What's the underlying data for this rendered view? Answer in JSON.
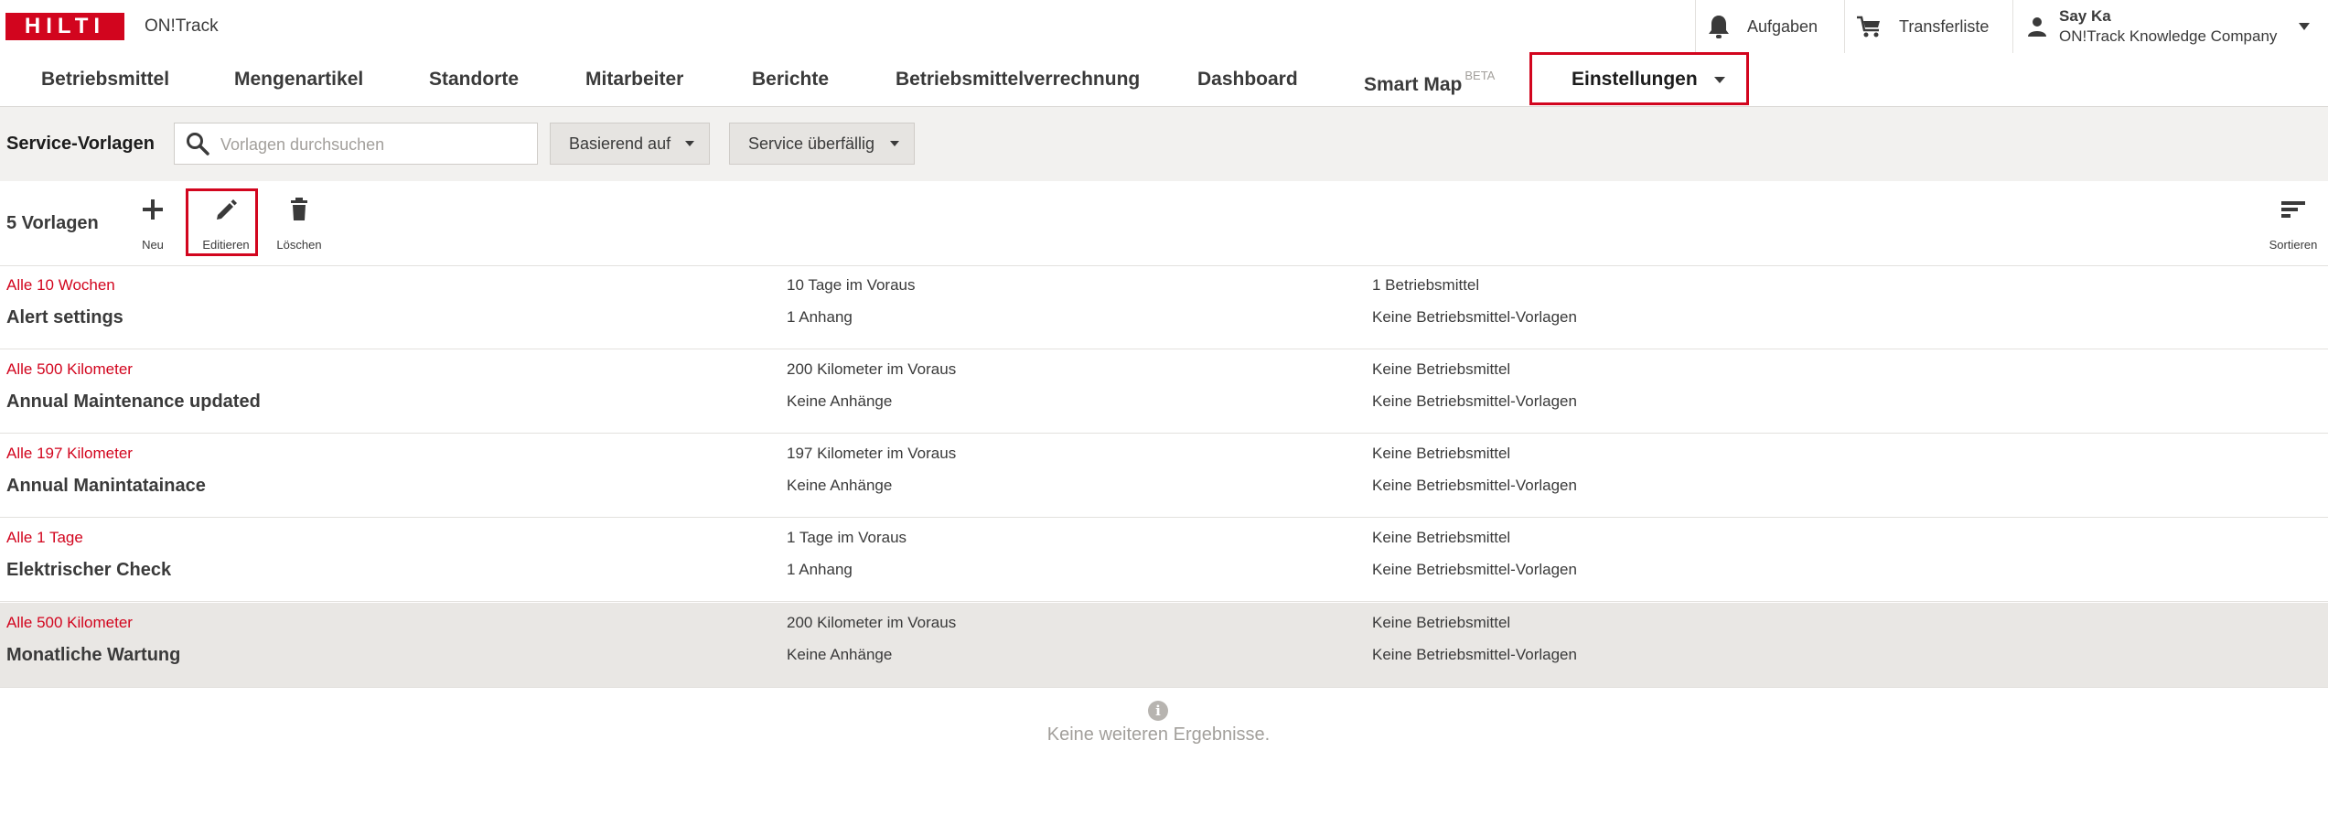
{
  "header": {
    "logo": "HILTI",
    "app_name": "ON!Track",
    "tasks_label": "Aufgaben",
    "transfer_label": "Transferliste",
    "user_name": "Say Ka",
    "company": "ON!Track Knowledge Company"
  },
  "nav": {
    "items": [
      "Betriebsmittel",
      "Mengenartikel",
      "Standorte",
      "Mitarbeiter",
      "Berichte",
      "Betriebsmittelverrechnung",
      "Dashboard",
      "Smart Map"
    ],
    "smart_map_badge": "BETA",
    "active": "Einstellungen"
  },
  "filter": {
    "title": "Service-Vorlagen",
    "search_placeholder": "Vorlagen durchsuchen",
    "dropdown1": "Basierend auf",
    "dropdown2": "Service überfällig"
  },
  "toolbar": {
    "count": "5 Vorlagen",
    "new_label": "Neu",
    "edit_label": "Editieren",
    "delete_label": "Löschen",
    "sort_label": "Sortieren"
  },
  "rows": [
    {
      "interval": "Alle 10 Wochen",
      "name": "Alert settings",
      "advance": "10 Tage im Voraus",
      "attachments": "1 Anhang",
      "assets": "1 Betriebsmittel",
      "templates": "Keine Betriebsmittel-Vorlagen"
    },
    {
      "interval": "Alle 500 Kilometer",
      "name": "Annual Maintenance updated",
      "advance": "200 Kilometer im Voraus",
      "attachments": "Keine Anhänge",
      "assets": "Keine Betriebsmittel",
      "templates": "Keine Betriebsmittel-Vorlagen"
    },
    {
      "interval": "Alle 197 Kilometer",
      "name": "Annual Manintatainace",
      "advance": "197 Kilometer im Voraus",
      "attachments": "Keine Anhänge",
      "assets": "Keine Betriebsmittel",
      "templates": "Keine Betriebsmittel-Vorlagen"
    },
    {
      "interval": "Alle 1 Tage",
      "name": "Elektrischer Check",
      "advance": "1 Tage im Voraus",
      "attachments": "1 Anhang",
      "assets": "Keine Betriebsmittel",
      "templates": "Keine Betriebsmittel-Vorlagen"
    },
    {
      "interval": "Alle 500 Kilometer",
      "name": "Monatliche Wartung",
      "advance": "200 Kilometer im Voraus",
      "attachments": "Keine Anhänge",
      "assets": "Keine Betriebsmittel",
      "templates": "Keine Betriebsmittel-Vorlagen"
    }
  ],
  "selected_row": 4,
  "footer_message": "Keine weiteren Ergebnisse.",
  "colors": {
    "brand": "#d2051e",
    "text": "#3a3a3a",
    "selected_row": "#e9e7e4",
    "filter_bg": "#f2f1ef"
  }
}
